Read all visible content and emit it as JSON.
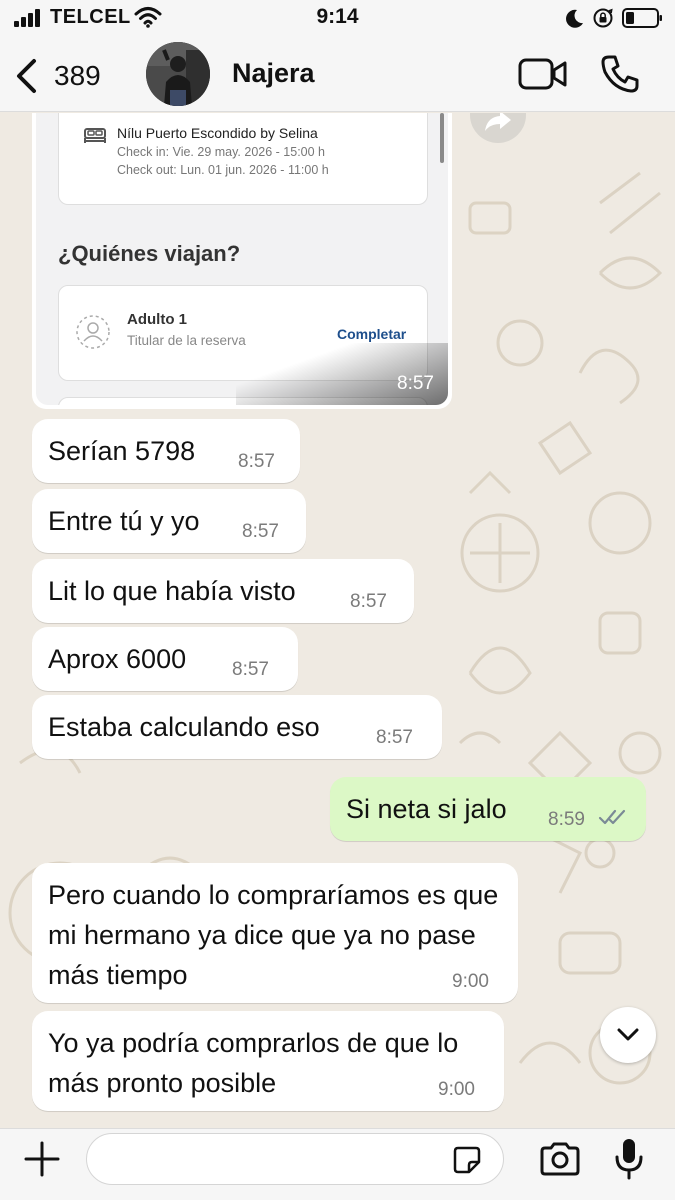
{
  "status_bar": {
    "carrier": "TELCEL",
    "time": "9:14",
    "icons": [
      "signal-icon",
      "wifi-icon",
      "moon-icon",
      "orientation-lock-icon",
      "battery-icon"
    ]
  },
  "header": {
    "back_count": "389",
    "contact_name": "Najera",
    "icons": [
      "chevron-left-icon",
      "video-camera-icon",
      "phone-icon"
    ]
  },
  "image_message": {
    "hotel_name": "Nílu Puerto Escondido by Selina",
    "check_in": "Check in: Vie. 29 may. 2026 - 15:00 h",
    "check_out": "Check out: Lun. 01 jun. 2026 - 11:00 h",
    "section_title": "¿Quiénes viajan?",
    "traveler_title": "Adulto 1",
    "traveler_subtitle": "Titular de la reserva",
    "complete_label": "Completar",
    "time": "8:57"
  },
  "messages": [
    {
      "direction": "in",
      "text": "Serían 5798",
      "time": "8:57"
    },
    {
      "direction": "in",
      "text": "Entre tú y yo",
      "time": "8:57"
    },
    {
      "direction": "in",
      "text": "Lit lo que había visto",
      "time": "8:57"
    },
    {
      "direction": "in",
      "text": "Aprox 6000",
      "time": "8:57"
    },
    {
      "direction": "in",
      "text": "Estaba calculando eso",
      "time": "8:57"
    },
    {
      "direction": "out",
      "text": "Si neta si jalo",
      "time": "8:59",
      "status": "read"
    },
    {
      "direction": "in",
      "text": "Pero cuando lo compraríamos es que mi hermano ya dice que ya no pase más tiempo",
      "time": "9:00"
    },
    {
      "direction": "in",
      "text": "Yo ya podría comprarlos de que lo más pronto posible",
      "time": "9:00"
    }
  ],
  "composer": {
    "input_value": "",
    "icons": [
      "plus-icon",
      "sticker-icon",
      "camera-icon",
      "microphone-icon"
    ]
  },
  "colors": {
    "chat_background": "#efeae2",
    "incoming_bubble": "#ffffff",
    "outgoing_bubble": "#dcf8c6",
    "read_ticks": "#7b8a96",
    "link_blue": "#1e4f8c"
  }
}
